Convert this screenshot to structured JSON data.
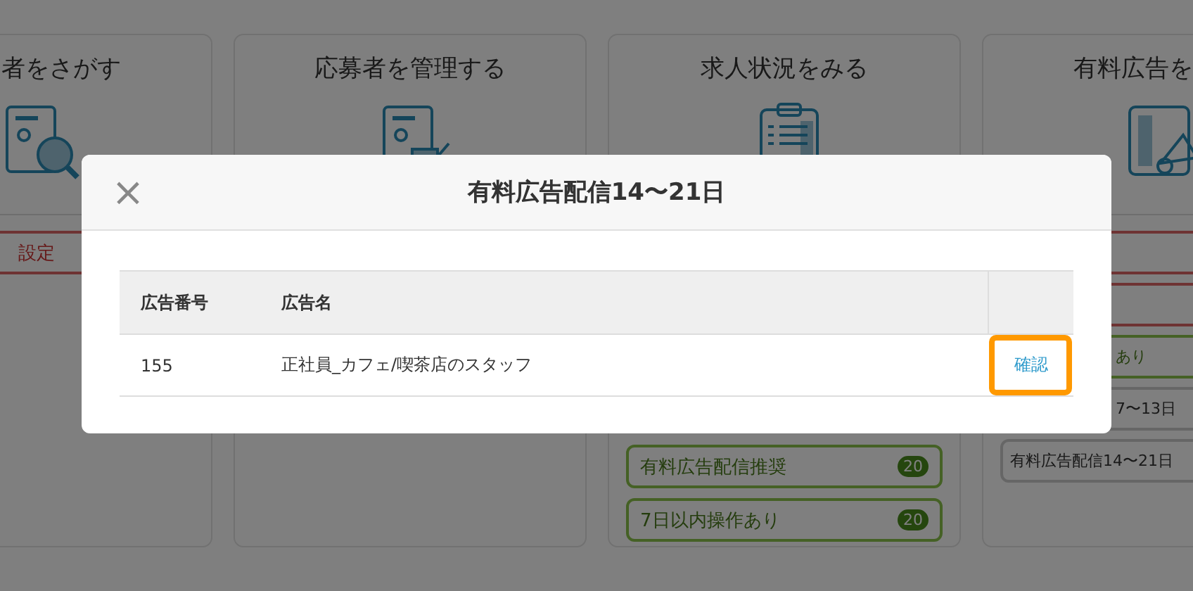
{
  "cards": [
    {
      "title": "者をさがす",
      "items": [
        {
          "kind": "alert",
          "label": "設定",
          "covered": false
        }
      ]
    },
    {
      "title": "応募者を管理する"
    },
    {
      "title": "求人状況をみる",
      "items": [
        {
          "kind": "green",
          "label": "有料広告配信推奨",
          "count": "20",
          "covered": false
        },
        {
          "kind": "green",
          "label": "7日以内操作あり",
          "count": "20",
          "covered": false
        }
      ]
    },
    {
      "title": "有料広告を",
      "items": [
        {
          "kind": "alert"
        },
        {
          "kind": "alert"
        },
        {
          "kind": "green",
          "label": "あり",
          "covered": true
        },
        {
          "kind": "gray",
          "label": "7〜13日",
          "covered": true
        },
        {
          "kind": "gray",
          "label": "有料広告配信14〜21日",
          "covered": false
        }
      ]
    }
  ],
  "dialog": {
    "title": "有料広告配信14〜21日",
    "close": "×",
    "table": {
      "columns": [
        "広告番号",
        "広告名"
      ],
      "rows": [
        {
          "number": "155",
          "name": "正社員_カフェ/喫茶店のスタッフ",
          "action": "確認",
          "highlighted": true
        }
      ]
    }
  }
}
